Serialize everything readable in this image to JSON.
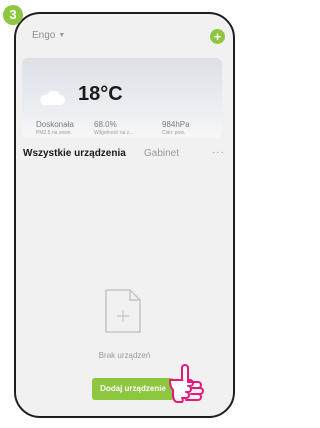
{
  "step_number": "3",
  "header": {
    "home_name": "Engo",
    "add_icon": "plus-circle-icon"
  },
  "weather": {
    "temperature": "18°C",
    "items": [
      {
        "value": "Doskonała",
        "label": "PM2.5 na zewn."
      },
      {
        "value": "68.0%",
        "label": "Wilgotność na z..."
      },
      {
        "value": "984hPa",
        "label": "Ciśn. pow."
      }
    ]
  },
  "tabs": {
    "active": "Wszystkie urządzenia",
    "other": "Gabinet",
    "more": "···"
  },
  "empty_state": {
    "text": "Brak urządzeń",
    "button_label": "Dodaj urządzenie"
  },
  "colors": {
    "accent": "#8dc63f",
    "frame": "#1f1f1f"
  }
}
